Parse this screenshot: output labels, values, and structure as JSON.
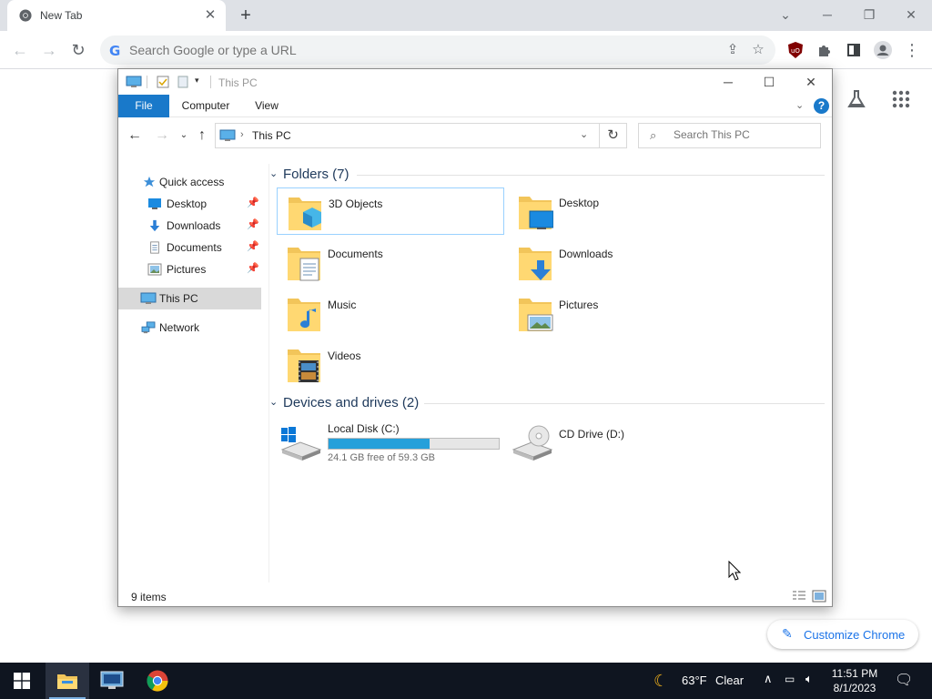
{
  "chrome": {
    "tab_title": "New Tab",
    "omnibox_placeholder": "Search Google or type a URL",
    "customize_label": "Customize Chrome"
  },
  "explorer": {
    "window_title": "This PC",
    "ribbon_tabs": [
      "File",
      "Computer",
      "View"
    ],
    "address": "This PC",
    "search_placeholder": "Search This PC",
    "nav": {
      "quick_access": "Quick access",
      "desktop": "Desktop",
      "downloads": "Downloads",
      "documents": "Documents",
      "pictures": "Pictures",
      "this_pc": "This PC",
      "network": "Network"
    },
    "folders_header": "Folders (7)",
    "folders": [
      "3D Objects",
      "Desktop",
      "Documents",
      "Downloads",
      "Music",
      "Pictures",
      "Videos"
    ],
    "devices_header": "Devices and drives (2)",
    "drives": {
      "c_name": "Local Disk (C:)",
      "c_free": "24.1 GB free of 59.3 GB",
      "c_used_fraction": 0.594,
      "d_name": "CD Drive (D:)"
    },
    "status": "9 items"
  },
  "taskbar": {
    "weather_temp": "63°F",
    "weather_cond": "Clear",
    "time": "11:51 PM",
    "date": "8/1/2023"
  },
  "colors": {
    "accent": "#1979ca",
    "chrome_blue": "#1a73e8",
    "drive_fill": "#26a0da",
    "taskbar": "#0f1520"
  }
}
